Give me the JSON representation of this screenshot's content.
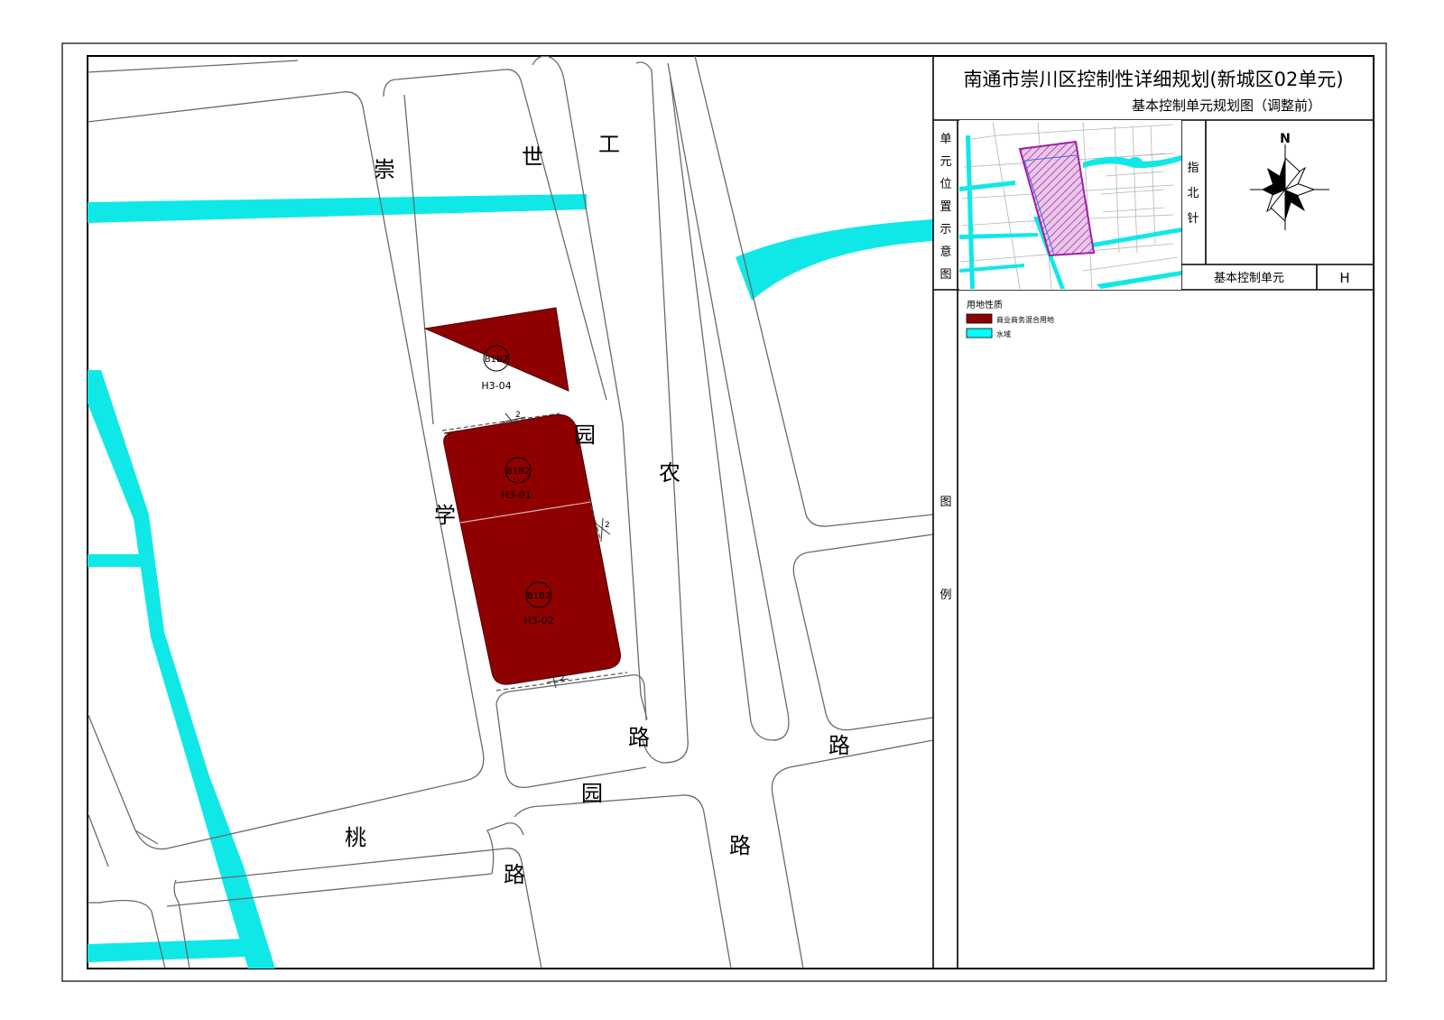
{
  "title": {
    "main": "南通市崇川区控制性详细规划(新城区02单元)",
    "sub": "基本控制单元规划图（调整前）"
  },
  "side_labels": {
    "location": "单元位置示意图",
    "north": "指北针",
    "legend": "图例"
  },
  "compass": {
    "north_label": "N"
  },
  "unit_table": {
    "label": "基本控制单元",
    "value": "H"
  },
  "legend": {
    "heading": "用地性质",
    "items": [
      {
        "label": "商业商务混合用地",
        "color": "#8f0000"
      },
      {
        "label": "水域",
        "color": "#00ffff"
      }
    ]
  },
  "road_labels": [
    "崇",
    "世",
    "工",
    "园",
    "农",
    "学",
    "路",
    "路",
    "园",
    "桃",
    "路",
    "路"
  ],
  "parcels": [
    {
      "code": "B1B2",
      "id": "H3-04"
    },
    {
      "code": "B1B2",
      "id": "H3-01"
    },
    {
      "code": "B1B2",
      "id": "H3-02"
    }
  ],
  "openings": [
    "2",
    "2",
    "2"
  ],
  "colors": {
    "water": "#10e8e8",
    "parcel": "#8f0000",
    "road_line": "#6a6a6a",
    "boundary": "#a020a0"
  }
}
